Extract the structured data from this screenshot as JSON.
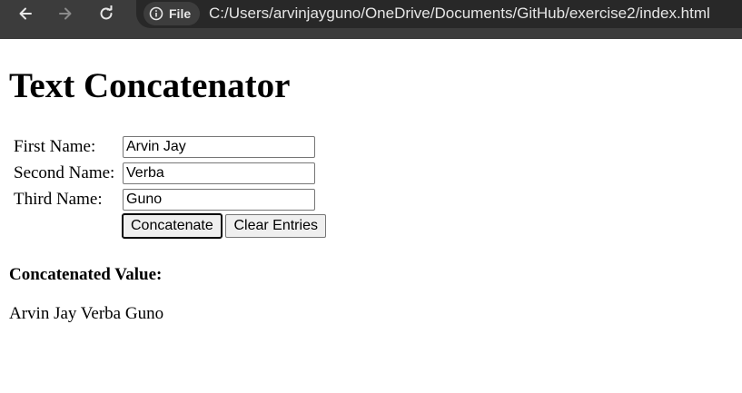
{
  "browser": {
    "back_icon": "arrow-left-icon",
    "forward_icon": "arrow-right-icon",
    "reload_icon": "reload-icon",
    "site_info_icon": "info-icon",
    "site_chip_label": "File",
    "url": "C:/Users/arvinjayguno/OneDrive/Documents/GitHub/exercise2/index.html"
  },
  "page": {
    "title": "Text Concatenator",
    "fields": [
      {
        "label": "First Name:",
        "value": "Arvin Jay"
      },
      {
        "label": "Second Name:",
        "value": "Verba"
      },
      {
        "label": "Third Name:",
        "value": "Guno"
      }
    ],
    "buttons": {
      "concatenate": "Concatenate",
      "clear": "Clear Entries"
    },
    "result_heading": "Concatenated Value:",
    "result_value": "Arvin Jay Verba Guno"
  }
}
